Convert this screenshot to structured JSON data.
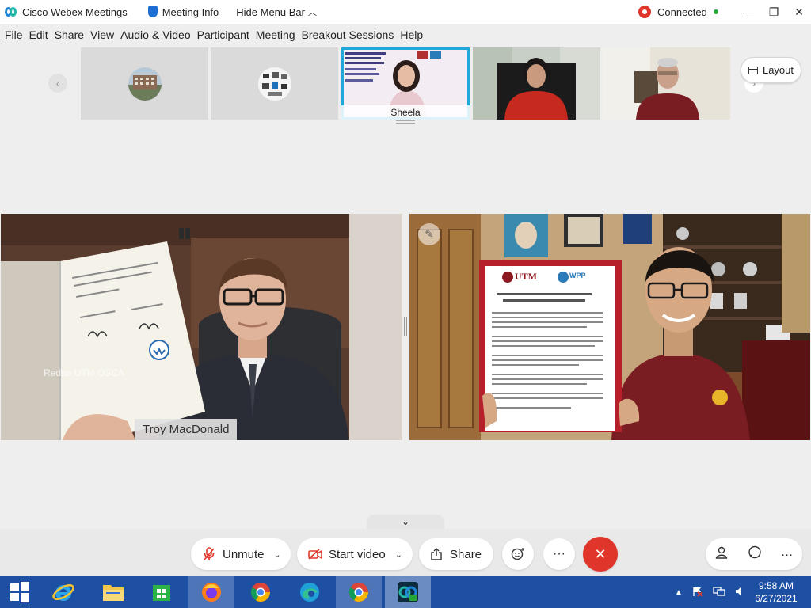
{
  "titlebar": {
    "app_title": "Cisco Webex Meetings",
    "meeting_info": "Meeting Info",
    "hide_menu_bar": "Hide Menu Bar",
    "status": "Connected"
  },
  "menu": [
    "File",
    "Edit",
    "Share",
    "View",
    "Audio & Video",
    "Participant",
    "Meeting",
    "Breakout Sessions",
    "Help"
  ],
  "filmstrip": {
    "selected_name": "Sheela",
    "layout_label": "Layout"
  },
  "videos": {
    "left_name": "Troy MacDonald",
    "left_watermark": "Redha UTM OSCA",
    "doc_logo_left": "UTM",
    "doc_logo_right": "WPP"
  },
  "controls": {
    "unmute": "Unmute",
    "start_video": "Start video",
    "share": "Share"
  },
  "taskbar": {
    "time": "9:58 AM",
    "date": "6/27/2021"
  },
  "icons": {
    "webex": "webex-logo-icon",
    "shield": "shield-icon",
    "record": "record-icon"
  },
  "colors": {
    "accent": "#1fa8d8",
    "end_call": "#e0352b",
    "taskbar": "#1d4fa3",
    "connected": "#2aa53a"
  }
}
